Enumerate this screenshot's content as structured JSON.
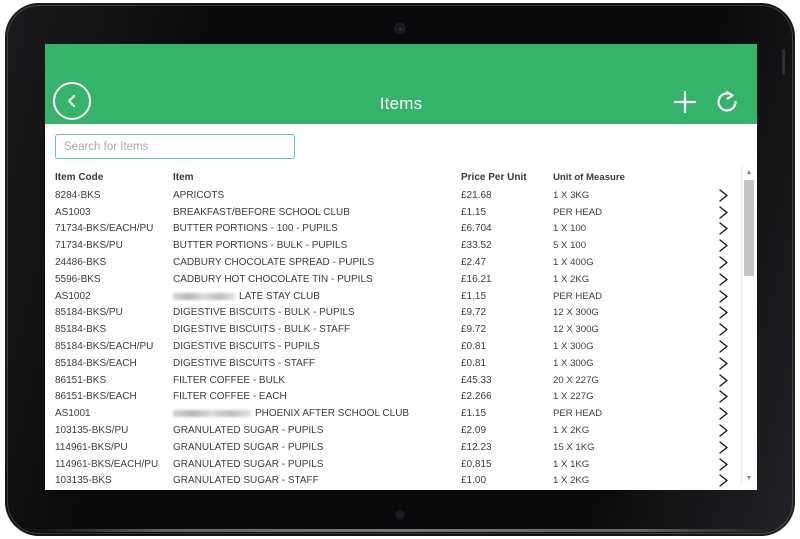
{
  "app": {
    "title": "Items",
    "header_color": "#35b36a",
    "back_icon": "chevron-left-icon",
    "add_icon": "plus-icon",
    "refresh_icon": "refresh-icon"
  },
  "search": {
    "placeholder": "Search for Items",
    "value": ""
  },
  "table": {
    "columns": {
      "code": "Item Code",
      "item": "Item",
      "price": "Price Per Unit",
      "unit": "Unit of Measure"
    },
    "row_chevron_icon": "chevron-right-icon",
    "rows": [
      {
        "code": "8284-BKS",
        "item": "APRICOTS",
        "price": "£21.68",
        "unit": "1 X 3KG",
        "redacted": false
      },
      {
        "code": "AS1003",
        "item": "BREAKFAST/BEFORE SCHOOL CLUB",
        "price": "£1.15",
        "unit": "PER HEAD",
        "redacted": false
      },
      {
        "code": "71734-BKS/EACH/PU",
        "item": "BUTTER PORTIONS - 100 - PUPILS",
        "price": "£6.704",
        "unit": "1 X 100",
        "redacted": false
      },
      {
        "code": "71734-BKS/PU",
        "item": "BUTTER PORTIONS - BULK - PUPILS",
        "price": "£33.52",
        "unit": "5 X 100",
        "redacted": false
      },
      {
        "code": "24486-BKS",
        "item": "CADBURY CHOCOLATE SPREAD - PUPILS",
        "price": "£2.47",
        "unit": "1 X 400G",
        "redacted": false
      },
      {
        "code": "5596-BKS",
        "item": "CADBURY HOT CHOCOLATE TIN - PUPILS",
        "price": "£16.21",
        "unit": "1 X 2KG",
        "redacted": false
      },
      {
        "code": "AS1002",
        "item": "LATE STAY CLUB",
        "price": "£1.15",
        "unit": "PER HEAD",
        "redacted": true
      },
      {
        "code": "85184-BKS/PU",
        "item": "DIGESTIVE BISCUITS - BULK - PUPILS",
        "price": "£9.72",
        "unit": "12 X 300G",
        "redacted": false
      },
      {
        "code": "85184-BKS",
        "item": "DIGESTIVE BISCUITS - BULK - STAFF",
        "price": "£9.72",
        "unit": "12 X 300G",
        "redacted": false
      },
      {
        "code": "85184-BKS/EACH/PU",
        "item": "DIGESTIVE BISCUITS - PUPILS",
        "price": "£0.81",
        "unit": "1 X 300G",
        "redacted": false
      },
      {
        "code": "85184-BKS/EACH",
        "item": "DIGESTIVE BISCUITS - STAFF",
        "price": "£0.81",
        "unit": "1 X 300G",
        "redacted": false
      },
      {
        "code": "86151-BKS",
        "item": "FILTER COFFEE - BULK",
        "price": "£45.33",
        "unit": "20 X 227G",
        "redacted": false
      },
      {
        "code": "86151-BKS/EACH",
        "item": "FILTER COFFEE - EACH",
        "price": "£2.266",
        "unit": "1 X 227G",
        "redacted": false
      },
      {
        "code": "AS1001",
        "item": "PHOENIX AFTER SCHOOL CLUB",
        "price": "£1.15",
        "unit": "PER HEAD",
        "redacted": true
      },
      {
        "code": "103135-BKS/PU",
        "item": "GRANULATED SUGAR - PUPILS",
        "price": "£2.09",
        "unit": "1 X 2KG",
        "redacted": false
      },
      {
        "code": "114961-BKS/PU",
        "item": "GRANULATED SUGAR - PUPILS",
        "price": "£12.23",
        "unit": "15 X 1KG",
        "redacted": false
      },
      {
        "code": "114961-BKS/EACH/PU",
        "item": "GRANULATED SUGAR - PUPILS",
        "price": "£0.815",
        "unit": "1 X 1KG",
        "redacted": false
      },
      {
        "code": "103135-BKS",
        "item": "GRANULATED SUGAR - STAFF",
        "price": "£1.00",
        "unit": "1 X 2KG",
        "redacted": false
      }
    ]
  },
  "scrollbar": {
    "up_icon": "scroll-up-arrow-icon",
    "down_icon": "scroll-down-arrow-icon"
  }
}
